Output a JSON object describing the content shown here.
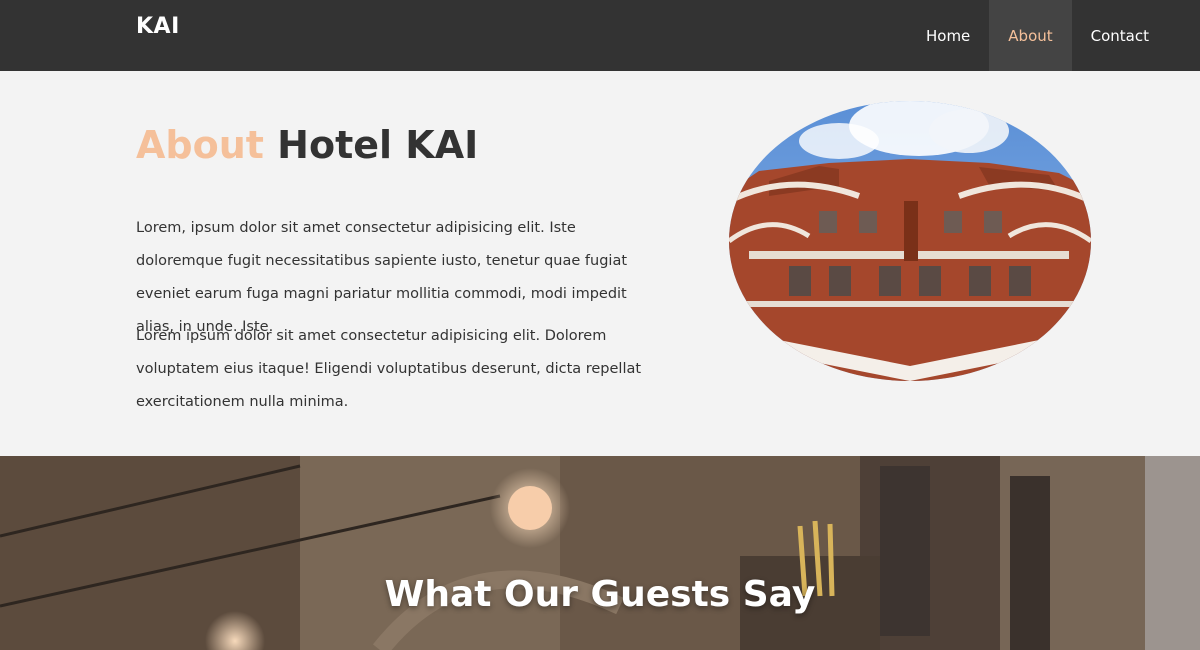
{
  "nav": {
    "brand": "KAI",
    "items": [
      {
        "label": "Home",
        "active": false
      },
      {
        "label": "About",
        "active": true
      },
      {
        "label": "Contact",
        "active": false
      }
    ]
  },
  "about": {
    "title_accent": "About",
    "title_rest": "Hotel KAI",
    "paragraphs": [
      "Lorem, ipsum dolor sit amet consectetur adipisicing elit. Iste doloremque fugit necessitatibus sapiente iusto, tenetur quae fugiat eveniet earum fuga magni pariatur mollitia commodi, modi impedit alias, in unde. Iste.",
      "Lorem ipsum dolor sit amet consectetur adipisicing elit. Dolorem voluptatem eius itaque! Eligendi voluptatibus deserunt, dicta repellat exercitationem nulla minima."
    ]
  },
  "guests": {
    "title": "What Our Guests Say"
  },
  "colors": {
    "accent": "#f5c09a",
    "navbar": "#333333",
    "nav_active_bg": "#444444",
    "section_bg": "#f3f3f3"
  }
}
